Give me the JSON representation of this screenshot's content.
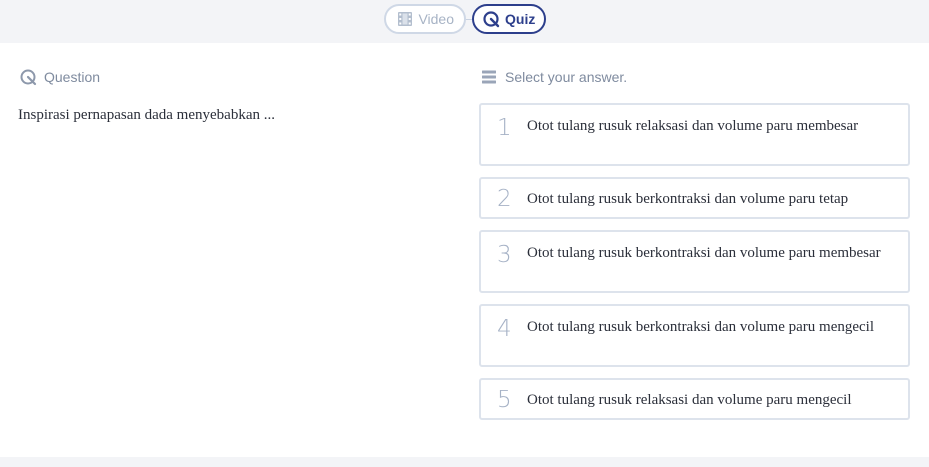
{
  "tabs": {
    "video_label": "Video",
    "quiz_label": "Quiz"
  },
  "question_section": {
    "header": "Question",
    "icon": "quiz-icon",
    "text": "Inspirasi pernapasan dada menyebabkan ..."
  },
  "answer_section": {
    "header": "Select your answer.",
    "icon": "list-icon",
    "options": [
      {
        "number": "1",
        "text": "Otot tulang rusuk relaksasi dan volume paru membesar"
      },
      {
        "number": "2",
        "text": "Otot tulang rusuk berkontraksi dan volume paru tetap"
      },
      {
        "number": "3",
        "text": "Otot tulang rusuk berkontraksi dan volume paru membesar"
      },
      {
        "number": "4",
        "text": "Otot tulang rusuk berkontraksi dan volume paru mengecil"
      },
      {
        "number": "5",
        "text": "Otot tulang rusuk relaksasi dan volume paru mengecil"
      }
    ]
  },
  "colors": {
    "accent": "#2d3f8c",
    "muted": "#a7b3c5",
    "border": "#dde3ec",
    "band": "#f3f4f7"
  }
}
